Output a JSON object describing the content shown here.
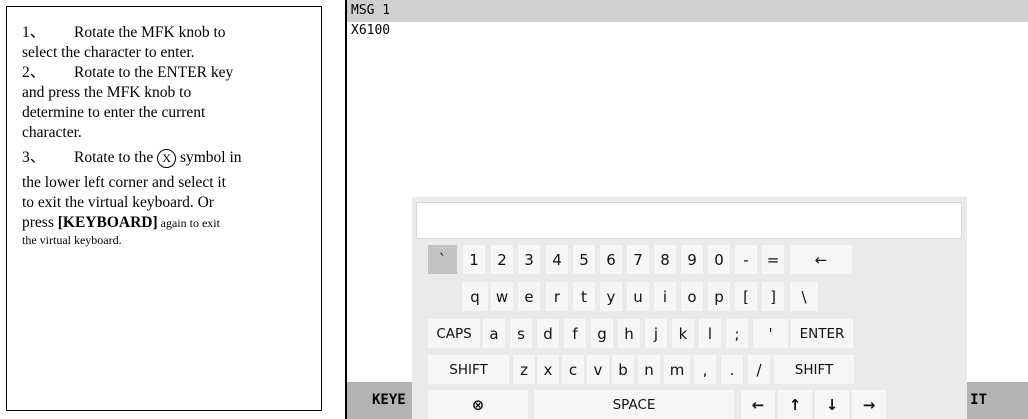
{
  "instructions": {
    "step1": {
      "num": "1、",
      "text_a": "Rotate the MFK knob to",
      "text_b": "select the character to enter."
    },
    "step2": {
      "num": "2、",
      "text_a": "Rotate to the ENTER key",
      "text_b": "and press the MFK knob to",
      "text_c": "determine to enter the current",
      "text_d": "character."
    },
    "step3": {
      "num": "3、",
      "text_a": "Rotate to the",
      "symbol": "X",
      "text_a2": "symbol in",
      "text_b": "the lower left corner and select it",
      "text_c": "to exit the virtual keyboard. Or",
      "text_d_pre": "press ",
      "text_d_bold": "[KEYBOARD]",
      "text_d_post": " again to exit",
      "text_e": "the virtual keyboard."
    }
  },
  "screen": {
    "title": "MSG 1",
    "content": "X6100",
    "softkey_left": "KEYE",
    "softkey_right": "IT"
  },
  "keyboard": {
    "row1": [
      "`",
      "1",
      "2",
      "3",
      "4",
      "5",
      "6",
      "7",
      "8",
      "9",
      "0",
      "-",
      "=",
      "←"
    ],
    "row2": [
      "q",
      "w",
      "e",
      "r",
      "t",
      "y",
      "u",
      "i",
      "o",
      "p",
      "[",
      "]",
      "\\"
    ],
    "row3": [
      "CAPS",
      "a",
      "s",
      "d",
      "f",
      "g",
      "h",
      "j",
      "k",
      "l",
      ";",
      "'",
      "ENTER"
    ],
    "row4": [
      "SHIFT",
      "z",
      "x",
      "c",
      "v",
      "b",
      "n",
      "m",
      ",",
      ".",
      "/",
      "SHIFT"
    ],
    "row5": [
      "⊗",
      "SPACE",
      "←",
      "↑",
      "↓",
      "→"
    ],
    "selected": "`"
  }
}
